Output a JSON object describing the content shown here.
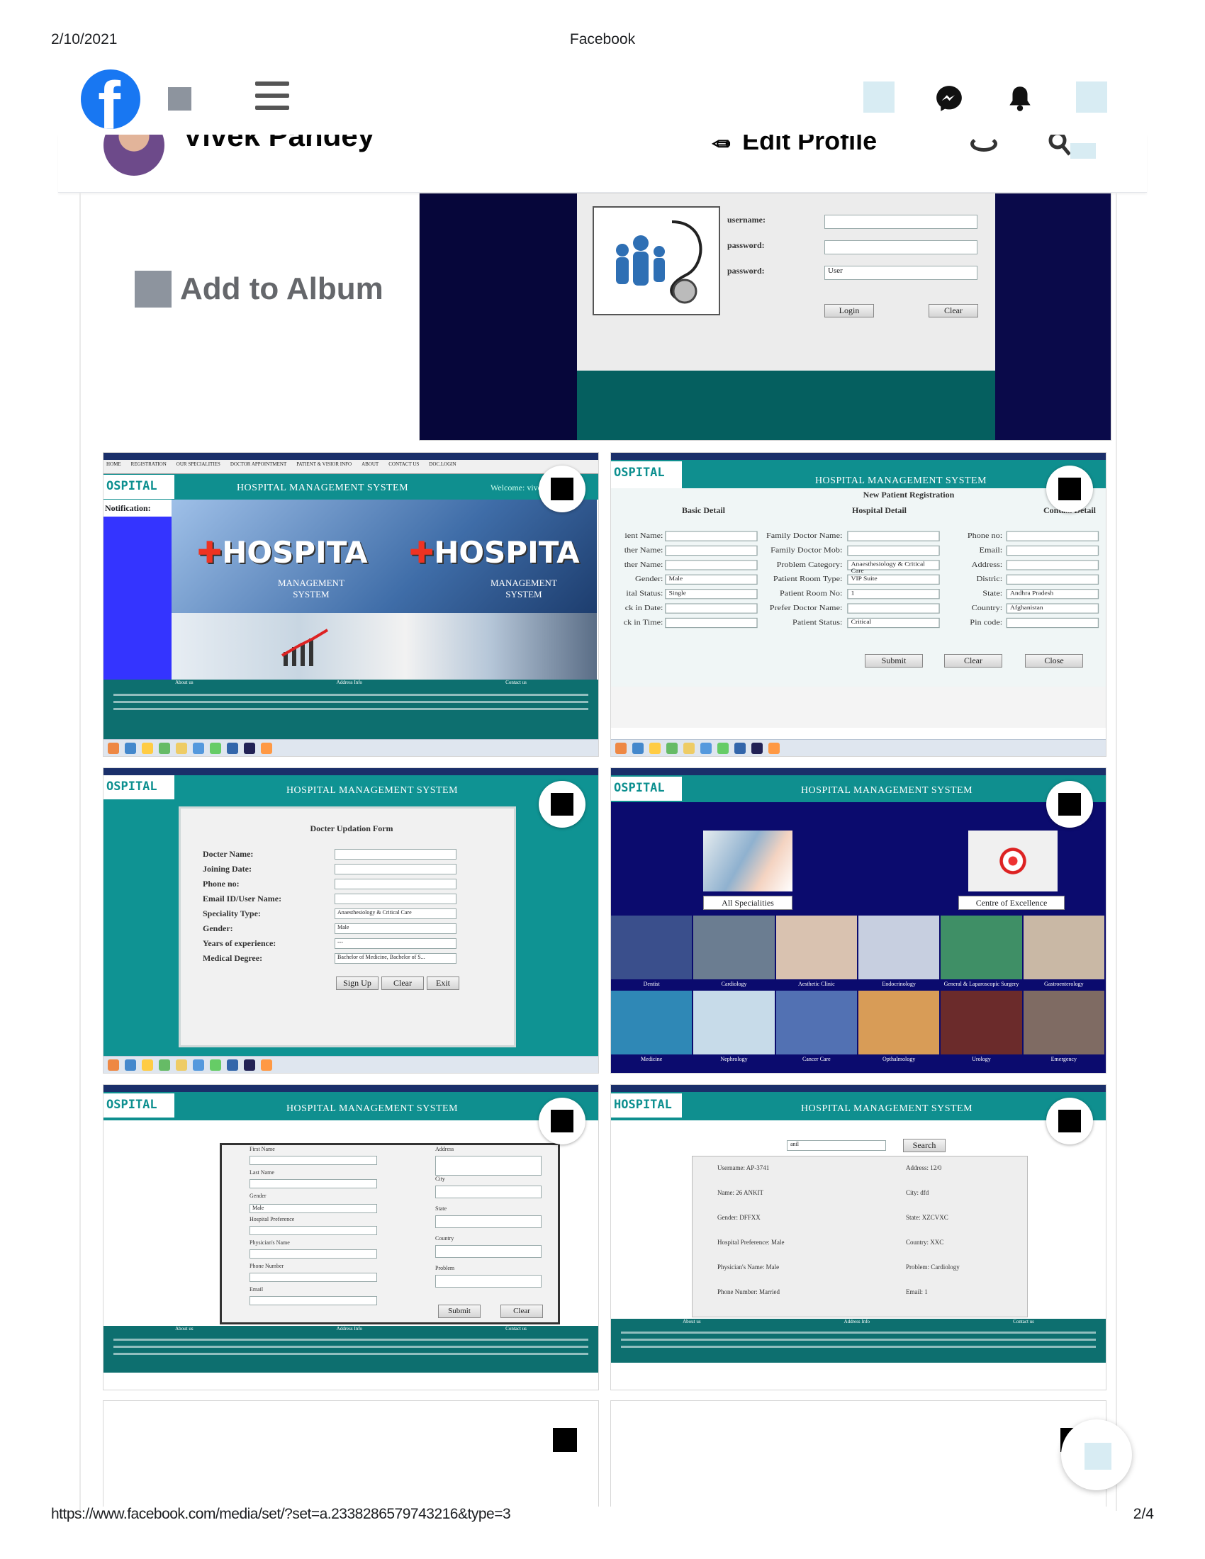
{
  "print": {
    "date": "2/10/2021",
    "title": "Facebook",
    "url": "https://www.facebook.com/media/set/?set=a.2338286579743216&type=3",
    "page": "2/4"
  },
  "topbar": {
    "logo_letter": "f",
    "icons": [
      "grey-square-icon",
      "hamburger-menu-icon",
      "messenger-icon",
      "notification-bell-icon"
    ]
  },
  "profile": {
    "name": "Vivek Pandey",
    "edit_label": "Edit Profile"
  },
  "album": {
    "add_label": "Add to Album"
  },
  "login_shot": {
    "username_label": "username:",
    "password_label": "password:",
    "role_label": "password:",
    "role_value": "User",
    "login_btn": "Login",
    "clear_btn": "Clear"
  },
  "home_shot": {
    "brand": "OSPITAL",
    "title": "HOSPITAL MANAGEMENT SYSTEM",
    "welcome": "Welcome: vive",
    "notification": "Notification:",
    "nav": [
      "HOME",
      "REGISTRATION",
      "OUR SPECIALITIES",
      "DOCTOR APPOINTMENT",
      "PATIENT & VISIOR INFO",
      "ABOUT",
      "CONTACT US",
      "DOC.LOGIN"
    ],
    "banner_word": "HOSPITA",
    "banner_sub1": "MANAGEMENT",
    "banner_sub2": "SYSTEM",
    "footer_heads": [
      "About us",
      "Address Info",
      "Contact us"
    ]
  },
  "reg_shot": {
    "brand": "OSPITAL",
    "title": "HOSPITAL MANAGEMENT SYSTEM",
    "subtitle": "New Patient Registration",
    "col_heads": [
      "Basic Detail",
      "Hospital Detail",
      "Conta... Detail"
    ],
    "left_labels": [
      "ient Name:",
      "ther Name:",
      "ther Name:",
      "Gender:",
      "ital Status:",
      "ck in Date:",
      "ck in Time:"
    ],
    "left_values": [
      "",
      "",
      "",
      "Male",
      "Single",
      "",
      ""
    ],
    "mid_labels": [
      "Family Doctor Name:",
      "Family Doctor Mob:",
      "Problem Category:",
      "Patient Room Type:",
      "Patient Room No:",
      "Prefer Doctor Name:",
      "Patient Status:"
    ],
    "mid_values": [
      "",
      "",
      "Anaesthesiology & Critical Care",
      "VIP Suite",
      "1",
      "",
      "Critical"
    ],
    "right_labels": [
      "Phone no:",
      "Email:",
      "Address:",
      "Distric:",
      "State:",
      "Country:",
      "Pin code:"
    ],
    "right_values": [
      "",
      "",
      "",
      "",
      "Andhra Pradesh",
      "Afghanistan",
      ""
    ],
    "buttons": [
      "Submit",
      "Clear",
      "Close"
    ]
  },
  "doc_shot": {
    "brand": "OSPITAL",
    "title": "HOSPITAL MANAGEMENT SYSTEM",
    "form_title": "Docter Updation Form",
    "labels": [
      "Docter Name:",
      "Joining Date:",
      "Phone no:",
      "Email ID/User Name:",
      "Speciality Type:",
      "Gender:",
      "Years of experience:",
      "Medical Degree:"
    ],
    "values": [
      "",
      "",
      "",
      "",
      "Anaesthesiology & Critical Care",
      "Male",
      "---",
      "Bachelor of Medicine, Bachelor of S..."
    ],
    "buttons": [
      "Sign Up",
      "Clear",
      "Exit"
    ]
  },
  "spec_shot": {
    "brand": "OSPITAL",
    "title": "HOSPITAL MANAGEMENT SYSTEM",
    "card1": "All Specialities",
    "card2": "Centre of Excellence",
    "row1": [
      "Dentist",
      "Cardiology",
      "Aesthetic Clinic",
      "Endocrinology",
      "General & Laparoscopic Surgery",
      "Gastroenterology"
    ],
    "row2": [
      "Medicine",
      "Nephrology",
      "Cancer Care",
      "Opthalmology",
      "Urology",
      "Emergency"
    ]
  },
  "form_shot": {
    "brand": "OSPITAL",
    "title": "HOSPITAL MANAGEMENT SYSTEM",
    "left_labels": [
      "First Name",
      "Last Name",
      "Gender",
      "Hospital Preference",
      "Physician's Name",
      "Phone Number",
      "Email"
    ],
    "gender_value": "Male",
    "right_labels": [
      "Address",
      "City",
      "State",
      "Country",
      "Problem"
    ],
    "buttons": [
      "Submit",
      "Clear"
    ],
    "footer_heads": [
      "About us",
      "Address Info",
      "Contact us"
    ]
  },
  "search_shot": {
    "brand": "HOSPITAL",
    "title": "HOSPITAL MANAGEMENT SYSTEM",
    "search_value": "anil",
    "search_btn": "Search",
    "left": [
      "Username:  AP-3741",
      "Name:  26 ANKIT",
      "Gender:  DFFXX",
      "Hospital Preference:  Male",
      "Physician's Name:  Male",
      "Phone Number:  Married"
    ],
    "right": [
      "Address:  12/0",
      "City:  dfd",
      "State:  XZCVXC",
      "Country:  XXC",
      "Problem:  Cardiology",
      "Email:  1"
    ],
    "footer_heads": [
      "About us",
      "Address Info",
      "Contact us"
    ]
  },
  "colors": {
    "facebook_blue": "#1877f2",
    "hms_teal": "#0f8f8f",
    "hms_navy": "#0a0a5e"
  }
}
